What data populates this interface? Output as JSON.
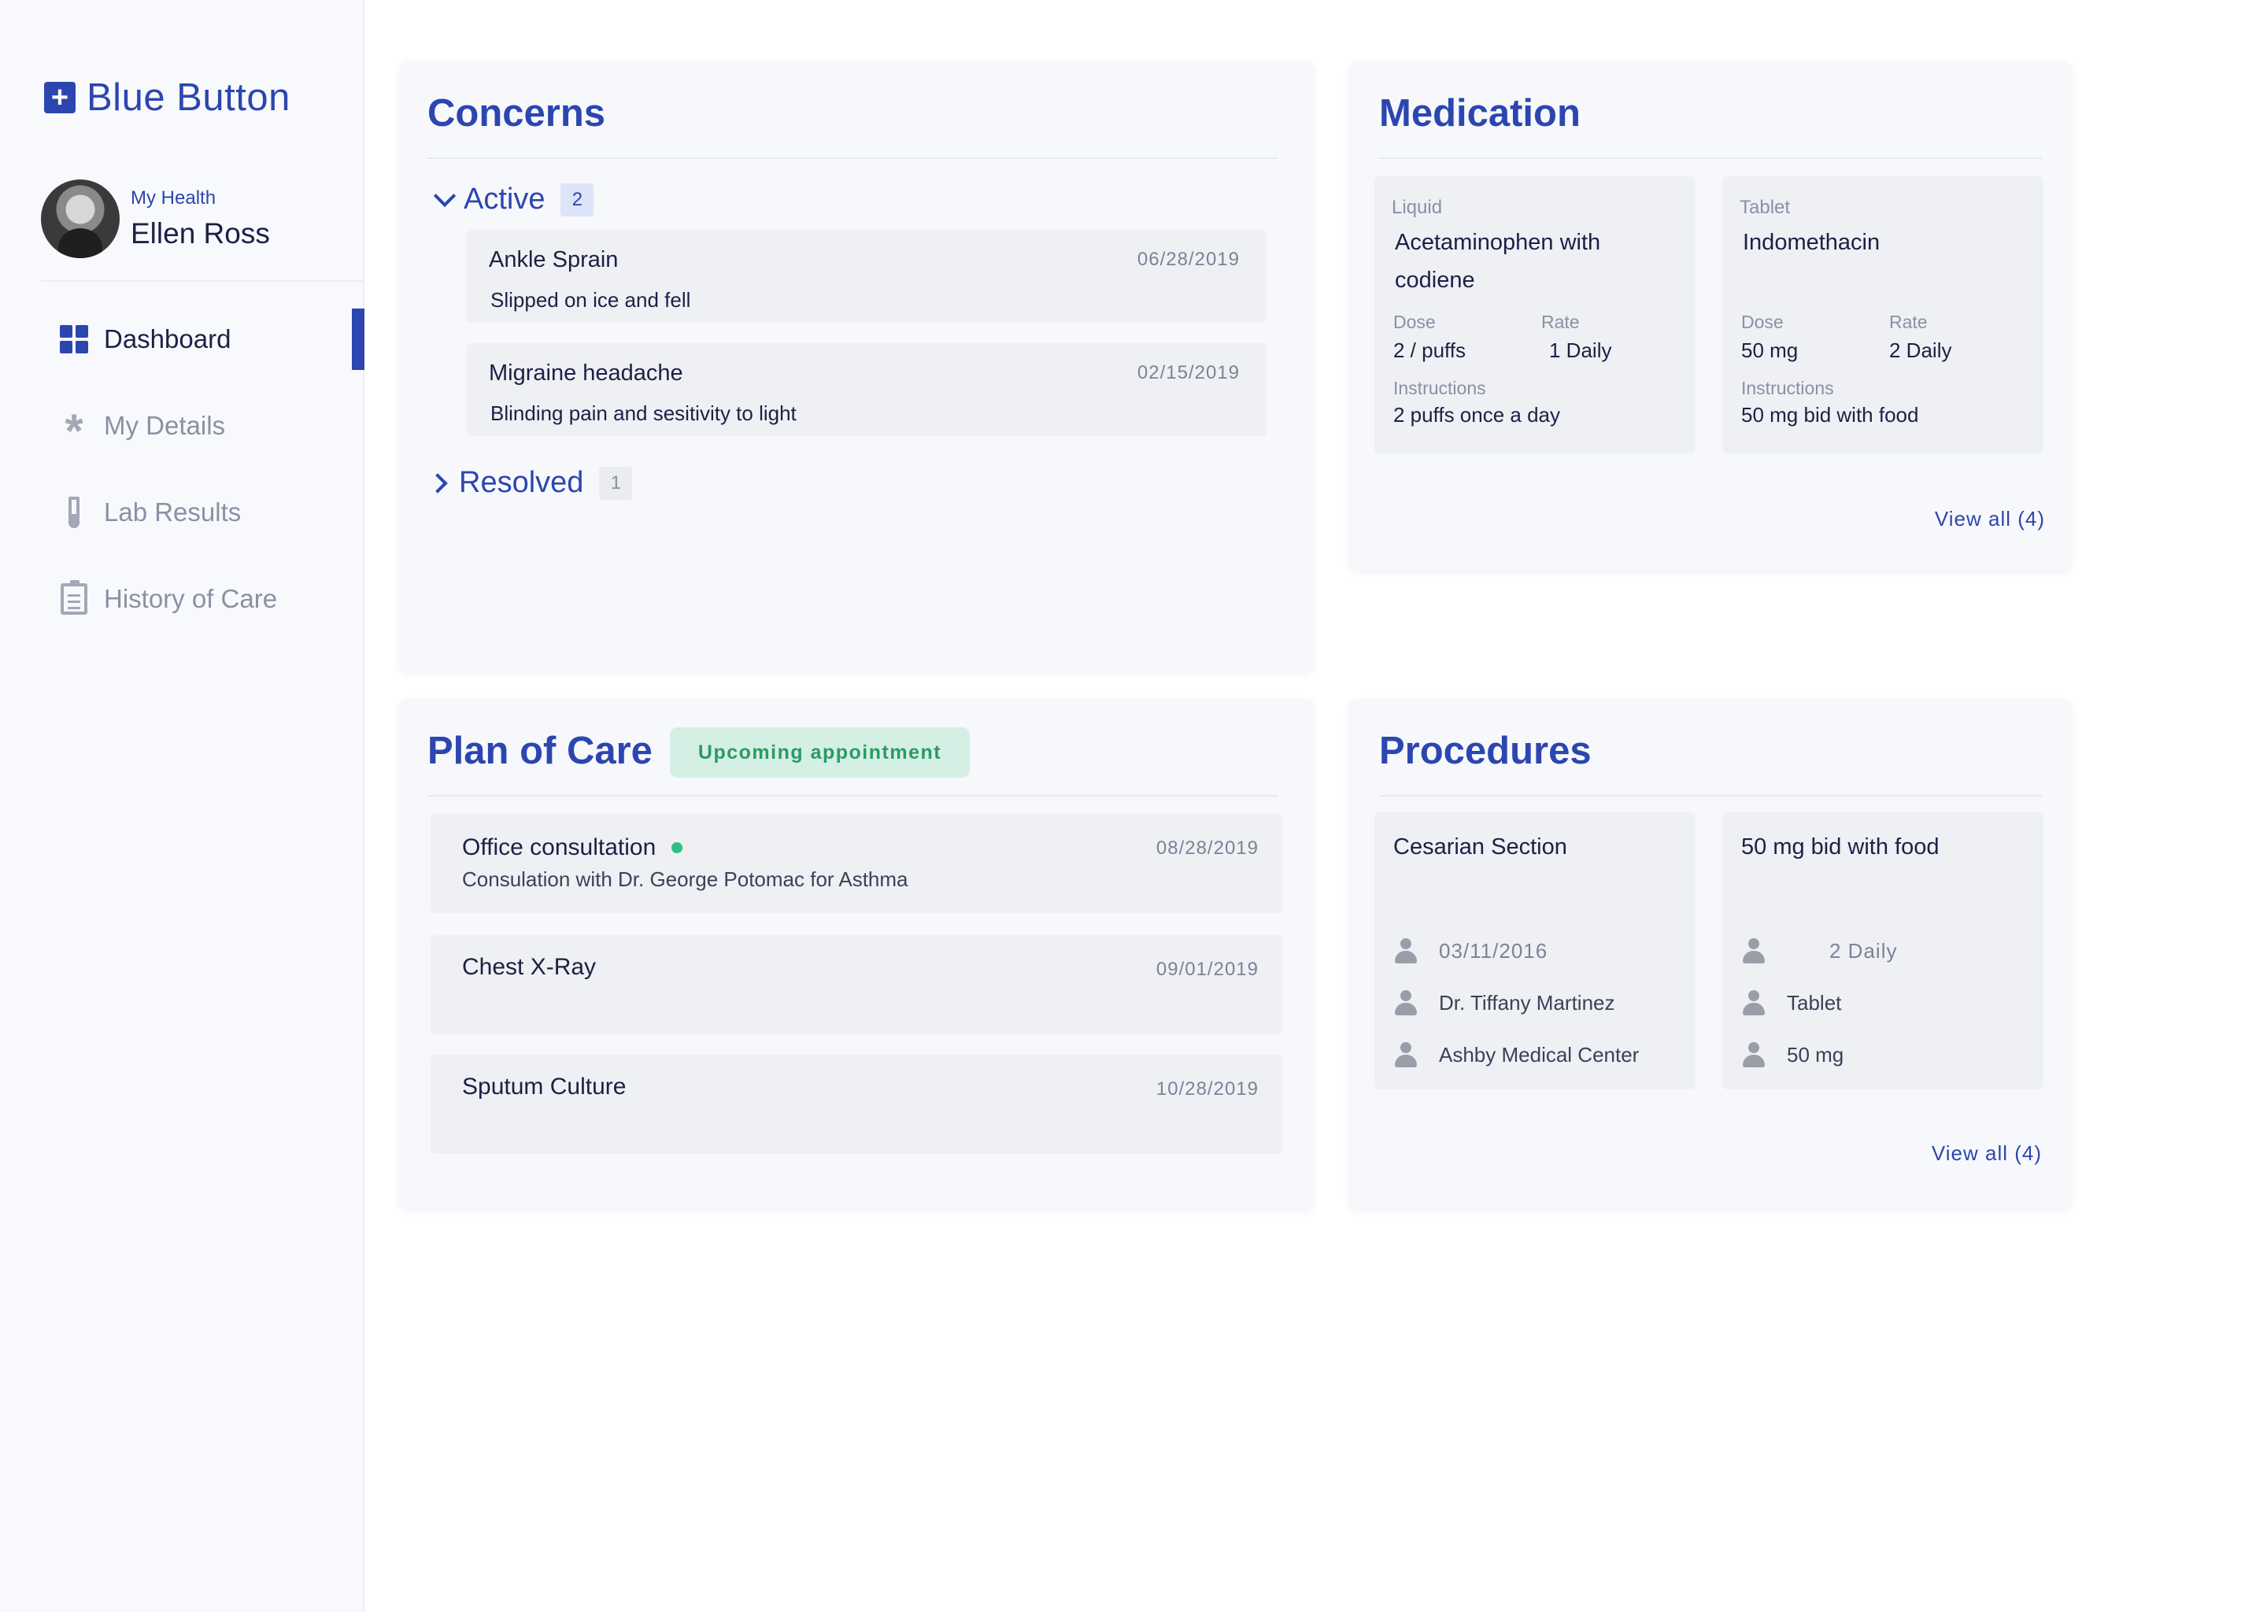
{
  "app": {
    "brand": "Blue Button",
    "brand_icon": "plus-square-icon",
    "accent_color": "#2c46b0"
  },
  "profile": {
    "subtitle": "My Health",
    "name": "Ellen Ross"
  },
  "nav": {
    "items": [
      {
        "label": "Dashboard",
        "icon": "dashboard-grid-icon",
        "active": true
      },
      {
        "label": "My Details",
        "icon": "asterisk-icon",
        "active": false
      },
      {
        "label": "Lab Results",
        "icon": "test-tube-icon",
        "active": false
      },
      {
        "label": "History of Care",
        "icon": "clipboard-icon",
        "active": false
      }
    ]
  },
  "concerns": {
    "title": "Concerns",
    "active": {
      "label": "Active",
      "count": "2",
      "items": [
        {
          "title": "Ankle Sprain",
          "description": "Slipped on ice and fell",
          "date": "06/28/2019"
        },
        {
          "title": "Migraine headache",
          "description": "Blinding pain and sesitivity to light",
          "date": "02/15/2019"
        }
      ]
    },
    "resolved": {
      "label": "Resolved",
      "count": "1"
    }
  },
  "medication": {
    "title": "Medication",
    "dose_label": "Dose",
    "rate_label": "Rate",
    "instructions_label": "Instructions",
    "items": [
      {
        "type": "Liquid",
        "name": "Acetaminophen with codiene",
        "dose": "2 / puffs",
        "rate": "1 Daily",
        "instructions": "2 puffs once a day"
      },
      {
        "type": "Tablet",
        "name": "Indomethacin",
        "dose": "50 mg",
        "rate": "2 Daily",
        "instructions": "50 mg bid with food"
      }
    ],
    "view_all": "View all (4)"
  },
  "plan_of_care": {
    "title": "Plan of Care",
    "badge": "Upcoming appointment",
    "status_color": "#2fbf84",
    "items": [
      {
        "title": "Office consultation",
        "description": "Consulation with Dr. George Potomac for Asthma",
        "date": "08/28/2019"
      },
      {
        "title": "Chest X-Ray",
        "description": "",
        "date": "09/01/2019"
      },
      {
        "title": "Sputum Culture",
        "description": "",
        "date": "10/28/2019"
      }
    ]
  },
  "procedures": {
    "title": "Procedures",
    "items": [
      {
        "title": "Cesarian Section",
        "date": "03/11/2016",
        "doctor": "Dr. Tiffany Martinez",
        "location": "Ashby Medical Center"
      },
      {
        "title": "50 mg bid with food",
        "date": "2 Daily",
        "doctor": "Tablet",
        "location": "50 mg"
      }
    ],
    "view_all": "View all (4)"
  }
}
